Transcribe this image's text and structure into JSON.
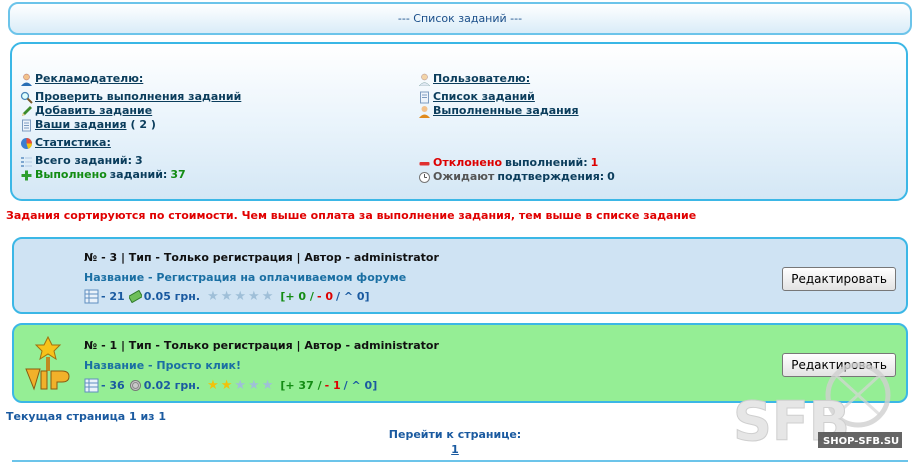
{
  "header": {
    "title": "--- Список заданий ---"
  },
  "advertiser": {
    "heading": "Рекламодателю:",
    "links": {
      "check": "Проверить выполнения заданий",
      "add": "Добавить задание",
      "yours": "Ваши задания",
      "yours_count": "( 2 )"
    }
  },
  "user": {
    "heading": "Пользователю:",
    "links": {
      "list": "Список заданий",
      "done": "Выполненные задания"
    }
  },
  "stats": {
    "heading": "Статистика:",
    "total_label": "Всего заданий:",
    "total_value": "3",
    "done_word": "Выполнено",
    "done_label": "заданий:",
    "done_value": "37",
    "rejected_word": "Отклонено",
    "rejected_label": "выполнений:",
    "rejected_value": "1",
    "waiting_word": "Ожидают",
    "waiting_label": "подтверждения:",
    "waiting_value": "0"
  },
  "notice": "Задания сортируются по стоимости. Чем выше оплата за выполнение задания, тем выше в списке задание",
  "tasks": [
    {
      "header": "№ - 3 | Тип - Только регистрация | Автор - administrator",
      "name": "Название - Регистрация на оплачиваемом форуме",
      "count": "- 21",
      "price": "0.05 грн.",
      "stars_on": 0,
      "stats_open": "[+ 0 /",
      "stats_minus": "- 0",
      "stats_close": "/ ^ 0]",
      "edit_label": "Редактировать",
      "vip": false
    },
    {
      "header": "№ - 1 | Тип - Только регистрация | Автор - administrator",
      "name": "Название - Просто клик!",
      "count": "- 36",
      "price": "0.02 грн.",
      "stars_on": 2,
      "stats_open": "[+ 37 /",
      "stats_minus": "- 1",
      "stats_close": "/ ^ 0]",
      "edit_label": "Редактировать",
      "vip": true
    }
  ],
  "pagination": {
    "current": "Текущая страница 1 из 1",
    "goto_label": "Перейти к странице:",
    "page": "1"
  },
  "watermark": {
    "big": "SFB",
    "small": "SHOP-SFB.SU"
  },
  "colors": {
    "accent_border": "#3bb7e6",
    "task_default": "#cfe3f3",
    "task_vip": "#95ee95",
    "alert": "#e00000"
  }
}
